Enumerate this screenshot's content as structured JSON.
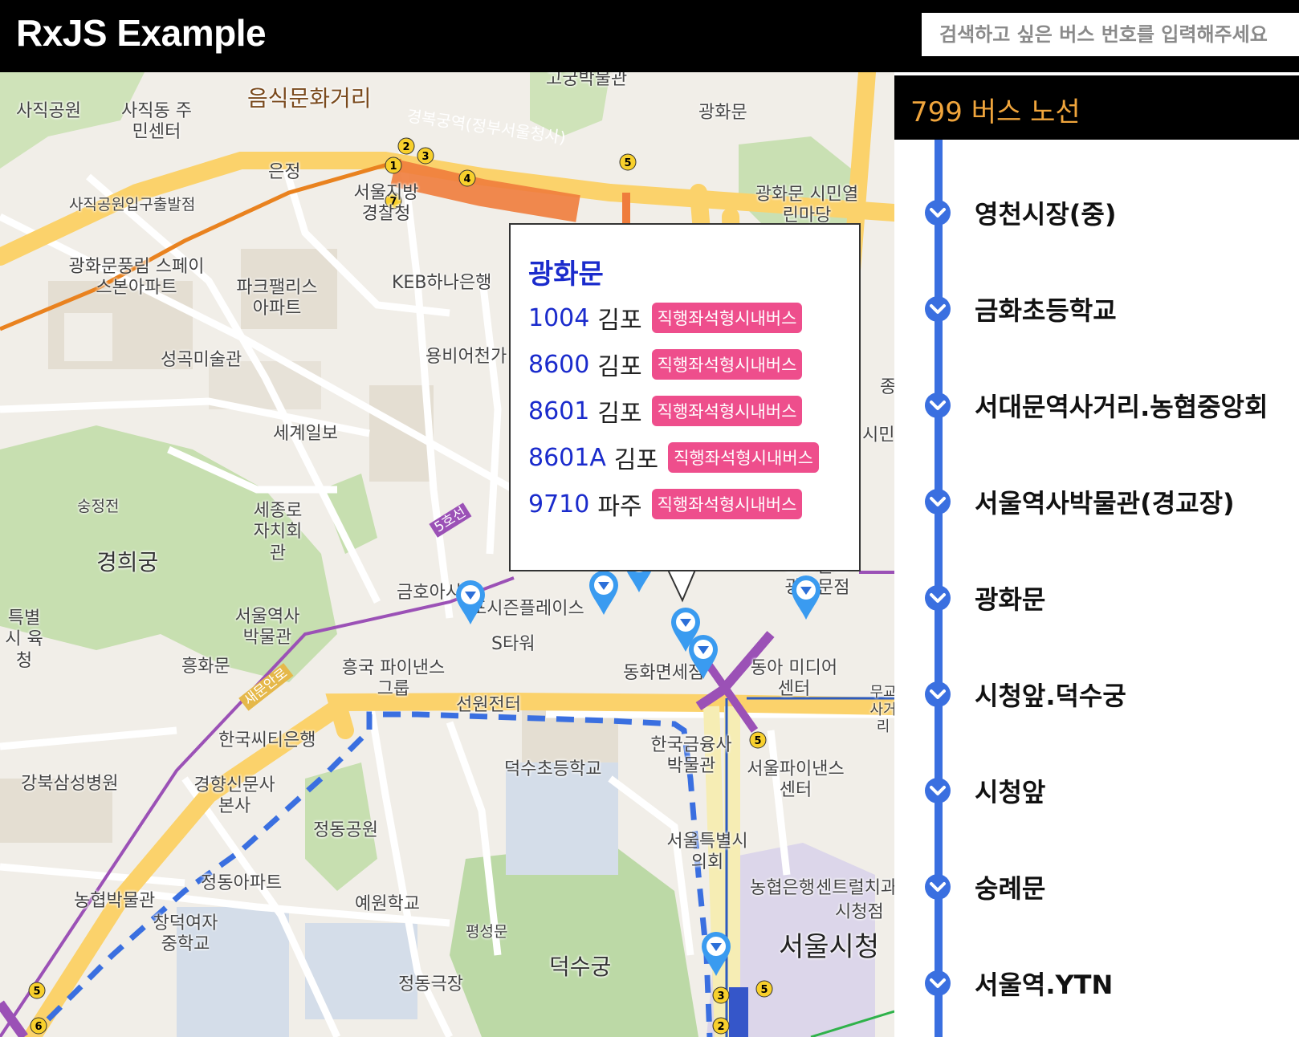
{
  "header": {
    "title": "RxJS Example",
    "search_placeholder": "검색하고 싶은 버스 번호를 입력해주세요"
  },
  "map": {
    "labels": [
      "사직공원",
      "사직동 주민센터",
      "음식문화거리",
      "경복궁역(정부서울청사)",
      "고궁박물관",
      "광화문",
      "은정",
      "서울지방 경찰청",
      "사직공원입구출발점",
      "광화문 시민열린마당",
      "광화문풍림 스페이스본아파트",
      "파크팰리스 아파트",
      "KEB하나은행",
      "성곡미술관",
      "용비어천가",
      "세계일보",
      "숭정전",
      "세종로 자치회관",
      "5호선",
      "경희궁",
      "금호아시",
      "포시즌플레이스",
      "서울역사 박물관",
      "S타워",
      "흥화문",
      "흥국 파이낸스그룹",
      "선원전터",
      "동화면세점",
      "동아 미디어센터",
      "새문안로",
      "한국씨티은행",
      "덕수초등학교",
      "한국금융사 박물관",
      "서울파이낸스 센터",
      "강북삼성병원",
      "경향신문사 본사",
      "정동공원",
      "서울특별시 의회",
      "정동아파트",
      "농협박물관",
      "창덕여자 중학교",
      "예원학교",
      "평성문",
      "농협은행",
      "센트럴치과",
      "시청점",
      "서울시청",
      "덕수궁",
      "정동극장",
      "교보문고 광화문점",
      "종로",
      "시민",
      "특별시 육청",
      "무교 사거리"
    ]
  },
  "popup": {
    "title": "광화문",
    "routes": [
      {
        "number": "1004",
        "region": "김포",
        "type": "직행좌석형시내버스"
      },
      {
        "number": "8600",
        "region": "김포",
        "type": "직행좌석형시내버스"
      },
      {
        "number": "8601",
        "region": "김포",
        "type": "직행좌석형시내버스"
      },
      {
        "number": "8601A",
        "region": "김포",
        "type": "직행좌석형시내버스"
      },
      {
        "number": "9710",
        "region": "파주",
        "type": "직행좌석형시내버스"
      }
    ]
  },
  "sidebar": {
    "route_title": "799 버스 노선",
    "stops": [
      "영천시장(중)",
      "금화초등학교",
      "서대문역사거리.농협중앙회",
      "서울역사박물관(경교장)",
      "광화문",
      "시청앞.덕수궁",
      "시청앞",
      "숭례문",
      "서울역.YTN"
    ]
  },
  "colors": {
    "accent_orange": "#f0a53c",
    "route_blue": "#3a6fe0",
    "popup_blue": "#1a2bcc",
    "badge_pink": "#ee4e8c"
  }
}
